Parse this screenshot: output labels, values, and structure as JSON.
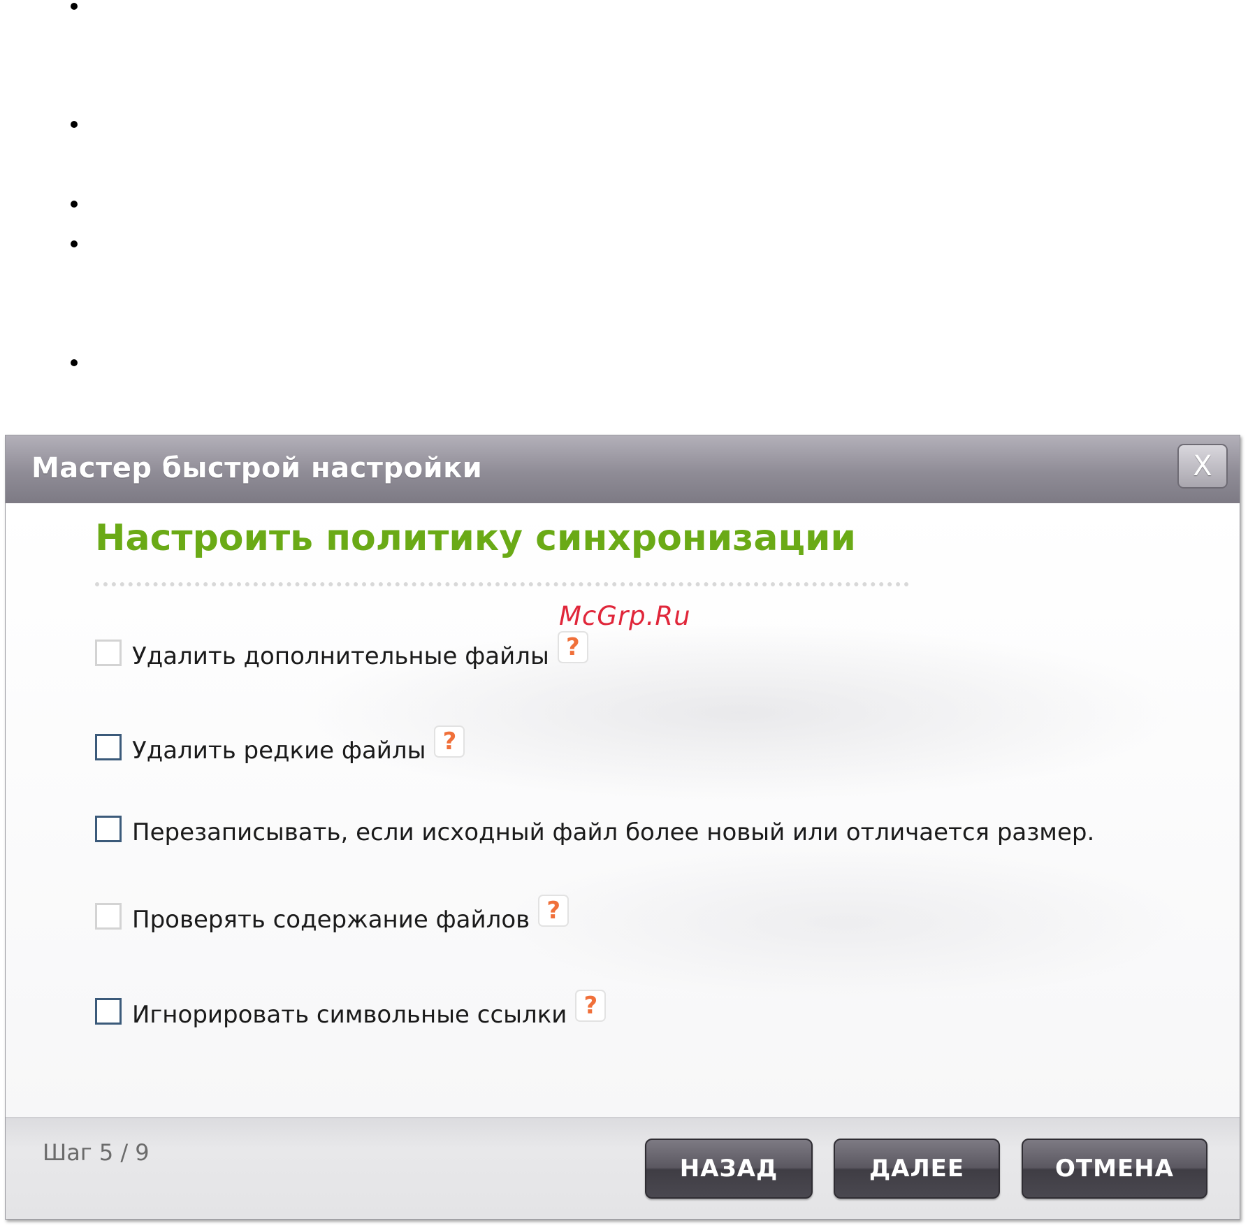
{
  "dialog": {
    "title": "Мастер быстрой настройки",
    "close_symbol": "X",
    "heading": "Настроить политику синхронизации",
    "watermark": "McGrp.Ru",
    "options": [
      {
        "label": "Удалить дополнительные файлы",
        "checked": false,
        "help": "?"
      },
      {
        "label": "Удалить редкие файлы",
        "checked": false,
        "help": "?"
      },
      {
        "label": "Перезаписывать, если исходный файл более новый или отличается размер.",
        "checked": false
      },
      {
        "label": "Проверять содержание файлов",
        "checked": false,
        "help": "?"
      },
      {
        "label": "Игнорировать символьные ссылки",
        "checked": false,
        "help": "?"
      }
    ],
    "step": "Шаг 5 / 9",
    "buttons": {
      "back": "НАЗАД",
      "next": "ДАЛЕЕ",
      "cancel": "ОТМЕНА"
    }
  },
  "colors": {
    "heading": "#6aaa16",
    "help_icon": "#f0703a",
    "watermark": "#e0263a",
    "titlebar": "#8f8c96"
  }
}
